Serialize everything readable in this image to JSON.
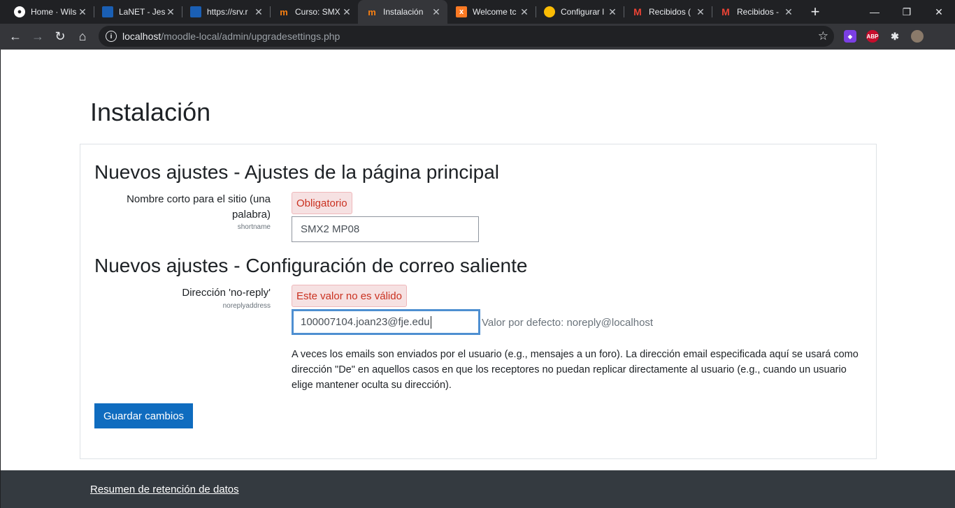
{
  "browser": {
    "tabs": [
      {
        "title": "Home · Wils",
        "icon": "github-icon"
      },
      {
        "title": "LaNET - Jes",
        "icon": "lanet-icon"
      },
      {
        "title": "https://srv.r",
        "icon": "lanet-icon"
      },
      {
        "title": "Curso: SMX",
        "icon": "moodle-icon"
      },
      {
        "title": "Instalación",
        "icon": "moodle-icon",
        "active": true
      },
      {
        "title": "Welcome tc",
        "icon": "xampp-icon"
      },
      {
        "title": "Configurar l",
        "icon": "bulb-icon"
      },
      {
        "title": "Recibidos (",
        "icon": "gmail-icon"
      },
      {
        "title": "Recibidos -",
        "icon": "gmail-icon"
      }
    ],
    "url_host": "localhost",
    "url_path": "/moodle-local/admin/upgradesettings.php",
    "ext_abp": "ABP"
  },
  "page": {
    "title": "Instalación",
    "sections": [
      {
        "heading": "Nuevos ajustes - Ajustes de la página principal",
        "label": "Nombre corto para el sitio (una palabra)",
        "sublabel": "shortname",
        "badge": "Obligatorio",
        "value": "SMX2 MP08"
      },
      {
        "heading": "Nuevos ajustes - Configuración de correo saliente",
        "label": "Dirección 'no-reply'",
        "sublabel": "noreplyaddress",
        "badge": "Este valor no es válido",
        "value": "100007104.joan23@fje.edu",
        "default": "Valor por defecto: noreply@localhost",
        "description": "A veces los emails son enviados por el usuario (e.g., mensajes a un foro). La dirección email especificada aquí se usará como dirección \"De\" en aquellos casos en que los receptores no puedan replicar directamente al usuario (e.g., cuando un usuario elige mantener oculta su dirección)."
      }
    ],
    "save_label": "Guardar cambios",
    "footer_link": "Resumen de retención de datos"
  }
}
